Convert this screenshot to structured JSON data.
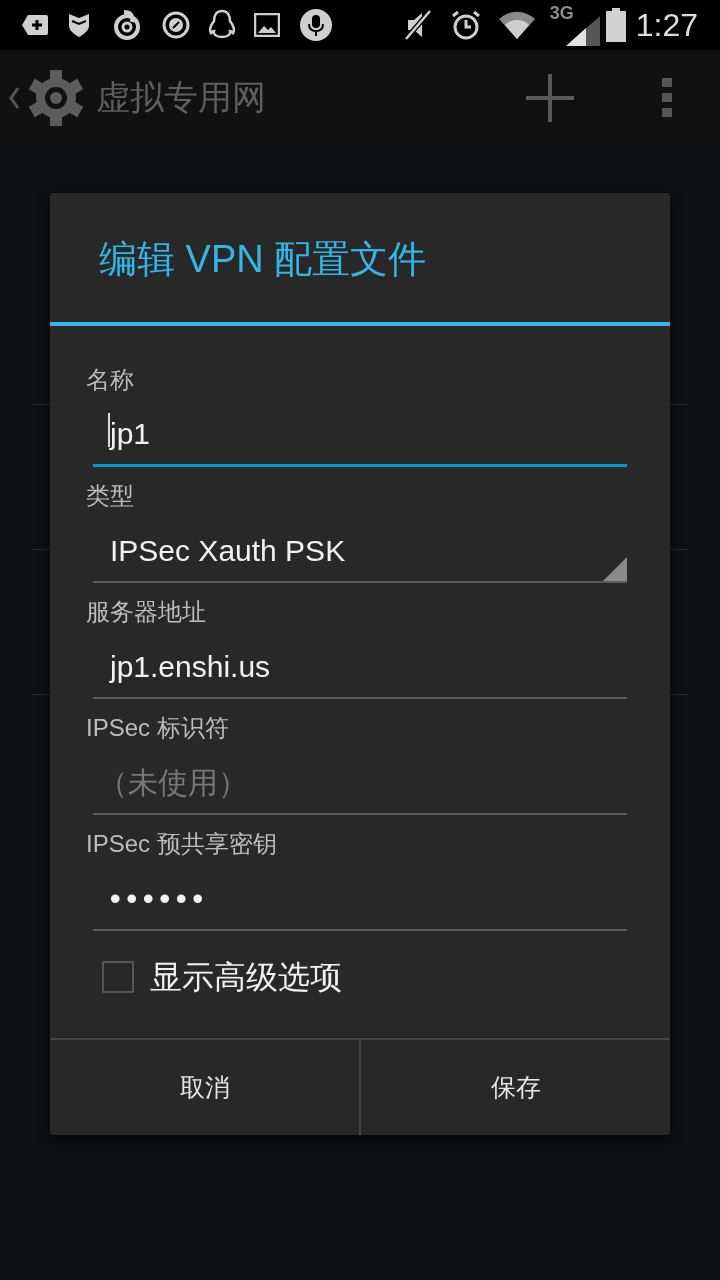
{
  "status_bar": {
    "network": "3G",
    "time": "1:27"
  },
  "action_bar": {
    "title": "虚拟专用网"
  },
  "dialog": {
    "title": "编辑 VPN 配置文件",
    "fields": [
      {
        "kind": "text",
        "label": "名称",
        "value": "jp1",
        "focused": true
      },
      {
        "kind": "spinner",
        "label": "类型",
        "value": "IPSec Xauth PSK"
      },
      {
        "kind": "text",
        "label": "服务器地址",
        "value": "jp1.enshi.us",
        "focused": false
      },
      {
        "kind": "text",
        "label": "IPSec 标识符",
        "placeholder": "（未使用）",
        "focused": false
      },
      {
        "kind": "password",
        "label": "IPSec 预共享密钥",
        "value": "••••••",
        "focused": false
      }
    ],
    "checkbox": {
      "label": "显示高级选项",
      "checked": false
    },
    "buttons": [
      "取消",
      "保存"
    ]
  }
}
